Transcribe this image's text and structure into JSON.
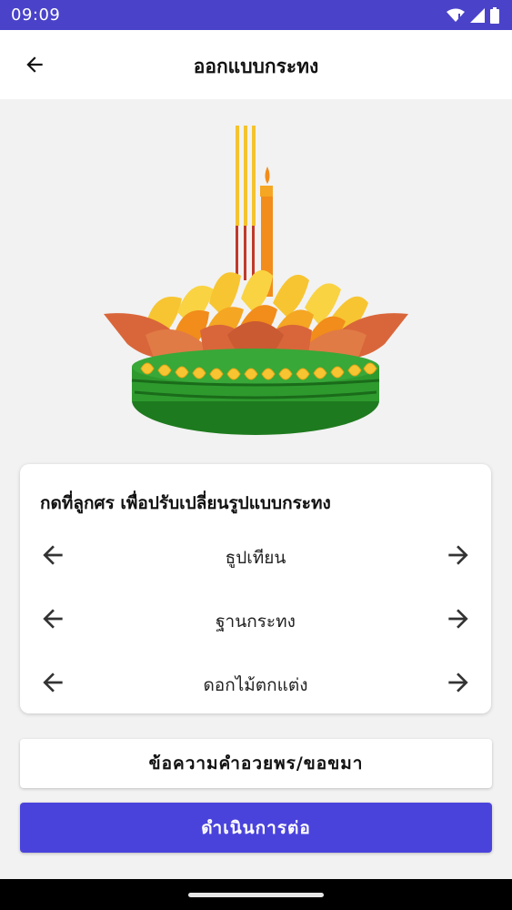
{
  "status_bar": {
    "time": "09:09",
    "icons": [
      "wifi-icon",
      "signal-icon",
      "battery-icon"
    ]
  },
  "app_bar": {
    "title": "ออกแบบกระทง",
    "back_icon": "arrow-left-icon"
  },
  "preview": {
    "image_name": "krathong-illustration"
  },
  "customize_card": {
    "title": "กดที่ลูกศร เพื่อปรับเปลี่ยนรูปแบบกระทง",
    "options": [
      {
        "label": "ธูปเทียน"
      },
      {
        "label": "ฐานกระทง"
      },
      {
        "label": "ดอกไม้ตกแต่ง"
      }
    ]
  },
  "buttons": {
    "message_label": "ข้อความคำอวยพร/ขอขมา",
    "continue_label": "ดำเนินการต่อ"
  },
  "colors": {
    "primary": "#4a43db",
    "status_bar": "#4a43c9"
  }
}
